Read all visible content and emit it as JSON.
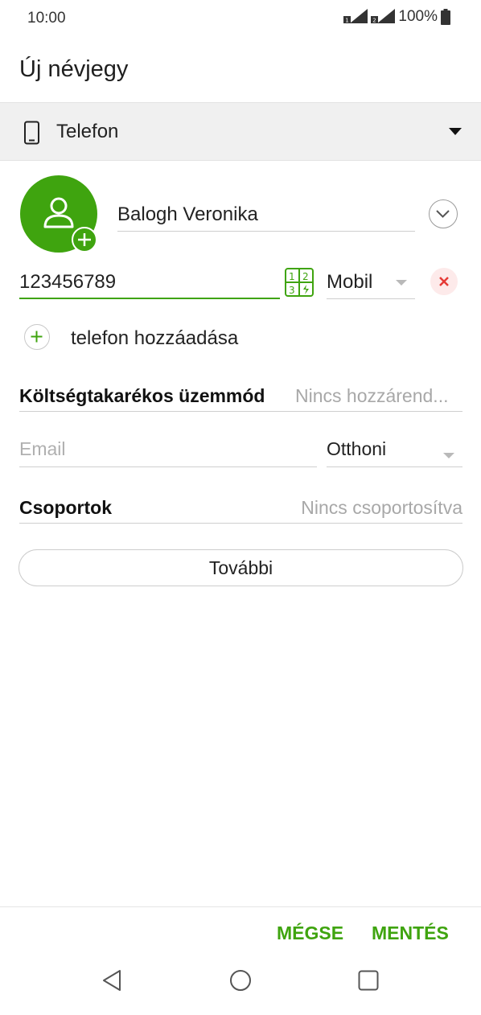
{
  "status_bar": {
    "time": "10:00",
    "battery": "100%"
  },
  "page": {
    "title": "Új névjegy"
  },
  "account": {
    "label": "Telefon"
  },
  "contact": {
    "name": "Balogh Veronika",
    "phone": "123456789",
    "phone_type": "Mobil",
    "add_phone_label": "telefon hozzáadása",
    "cost_saving_label": "Költségtakarékos üzemmód",
    "cost_saving_value": "Nincs hozzárend...",
    "email_placeholder": "Email",
    "email_type": "Otthoni",
    "groups_label": "Csoportok",
    "groups_value": "Nincs csoportosítva"
  },
  "buttons": {
    "more": "További",
    "cancel": "MÉGSE",
    "save": "MENTÉS"
  },
  "colors": {
    "accent": "#3fa40f",
    "remove": "#e53935"
  }
}
